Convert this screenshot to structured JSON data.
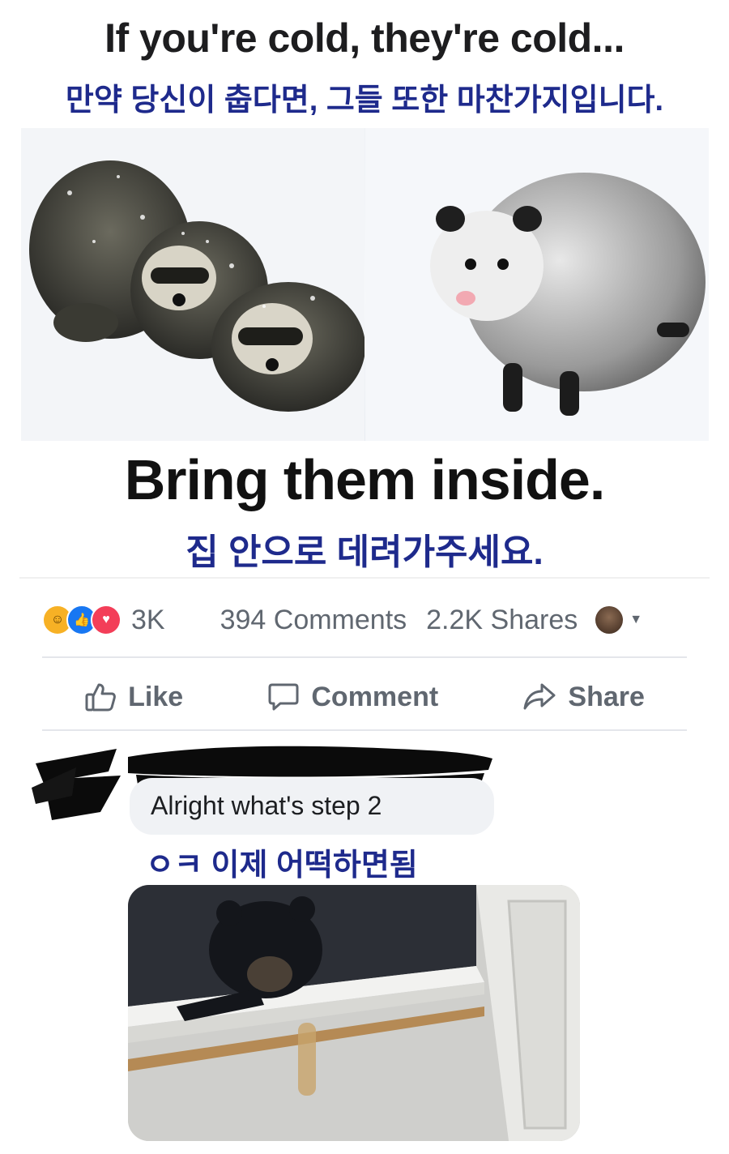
{
  "meme": {
    "title": "If you're cold, they're cold...",
    "title_ko": "만약 당신이 춥다면, 그들 또한 마찬가지입니다.",
    "left_photo_desc": "raccoons-in-snow",
    "right_photo_desc": "opossum-in-snow",
    "bring": "Bring them inside.",
    "bring_ko": "집 안으로 데려가주세요."
  },
  "post": {
    "reaction_icons": [
      "haha",
      "like",
      "love"
    ],
    "reaction_count": "3K",
    "comments": "394 Comments",
    "shares": "2.2K Shares"
  },
  "actions": {
    "like": "Like",
    "comment": "Comment",
    "share": "Share"
  },
  "comment": {
    "text": "Alright what's step 2",
    "translation_ko": "ㅇㅋ 이제 어떡하면됨",
    "photo_desc": "bear-in-closet"
  },
  "colors": {
    "korean_text": "#1e2a8c",
    "meta_text": "#606770",
    "bubble_bg": "#f0f2f5",
    "like_blue": "#1877f2",
    "love_red": "#f33e58",
    "haha_yellow": "#f7b125"
  }
}
